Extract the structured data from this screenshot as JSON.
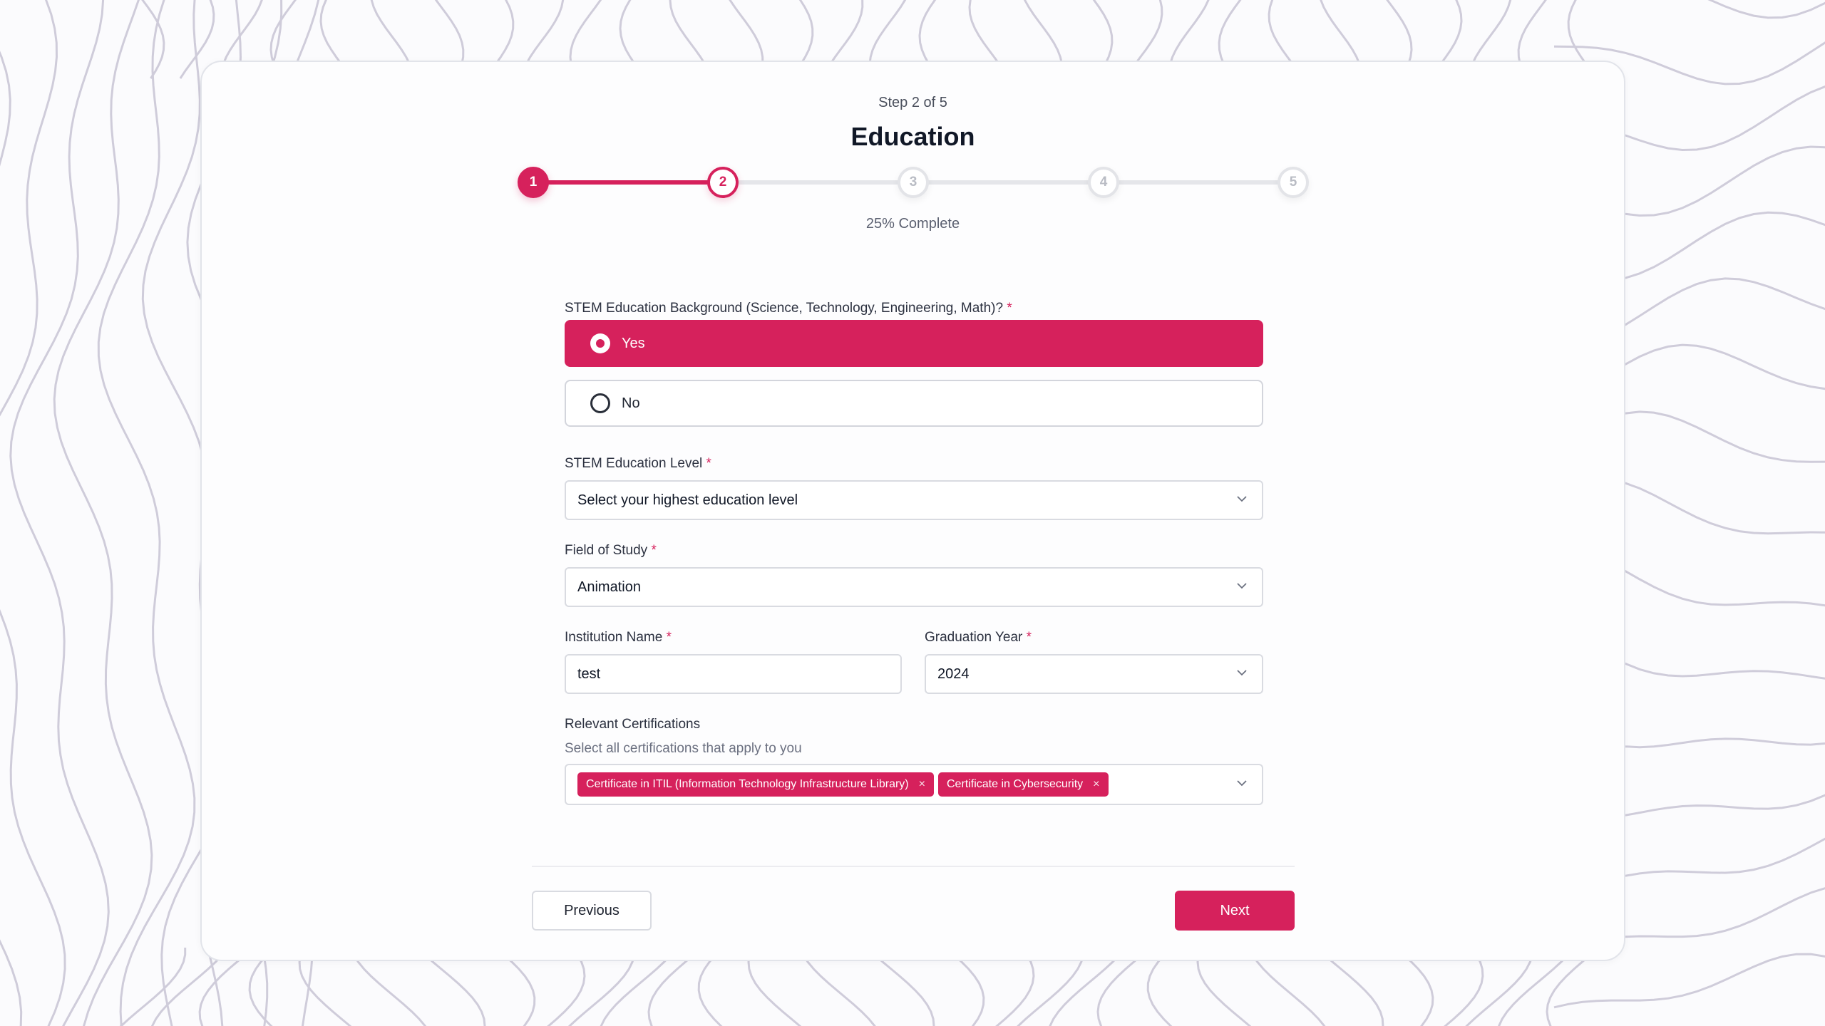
{
  "header": {
    "step_text": "Step 2 of 5",
    "title": "Education",
    "progress_text": "25% Complete"
  },
  "stepper": {
    "current_step": 2,
    "total_steps": 5,
    "progress_fraction": 0.25,
    "steps": [
      {
        "label": "1",
        "state": "done"
      },
      {
        "label": "2",
        "state": "current"
      },
      {
        "label": "3",
        "state": "todo"
      },
      {
        "label": "4",
        "state": "todo"
      },
      {
        "label": "5",
        "state": "todo"
      }
    ]
  },
  "form": {
    "stem_background": {
      "label": "STEM Education Background (Science, Technology, Engineering, Math)?",
      "required_mark": "*",
      "options": [
        {
          "label": "Yes",
          "selected": true
        },
        {
          "label": "No",
          "selected": false
        }
      ]
    },
    "education_level": {
      "label": "STEM Education Level",
      "required_mark": "*",
      "value": "Select your highest education level"
    },
    "field_of_study": {
      "label": "Field of Study",
      "required_mark": "*",
      "value": "Animation"
    },
    "institution_name": {
      "label": "Institution Name",
      "required_mark": "*",
      "value": "test"
    },
    "graduation_year": {
      "label": "Graduation Year",
      "required_mark": "*",
      "value": "2024"
    },
    "certifications": {
      "label": "Relevant Certifications",
      "hint": "Select all certifications that apply to you",
      "selected": [
        "Certificate in ITIL (Information Technology Infrastructure Library)",
        "Certificate in Cybersecurity"
      ],
      "remove_glyph": "×"
    }
  },
  "footer": {
    "previous_label": "Previous",
    "next_label": "Next"
  },
  "colors": {
    "accent": "#d6215c",
    "background_lines": "#cfccda"
  },
  "icons": [
    "chevron-down-icon",
    "close-icon",
    "radio-selected-icon",
    "radio-unselected-icon"
  ]
}
